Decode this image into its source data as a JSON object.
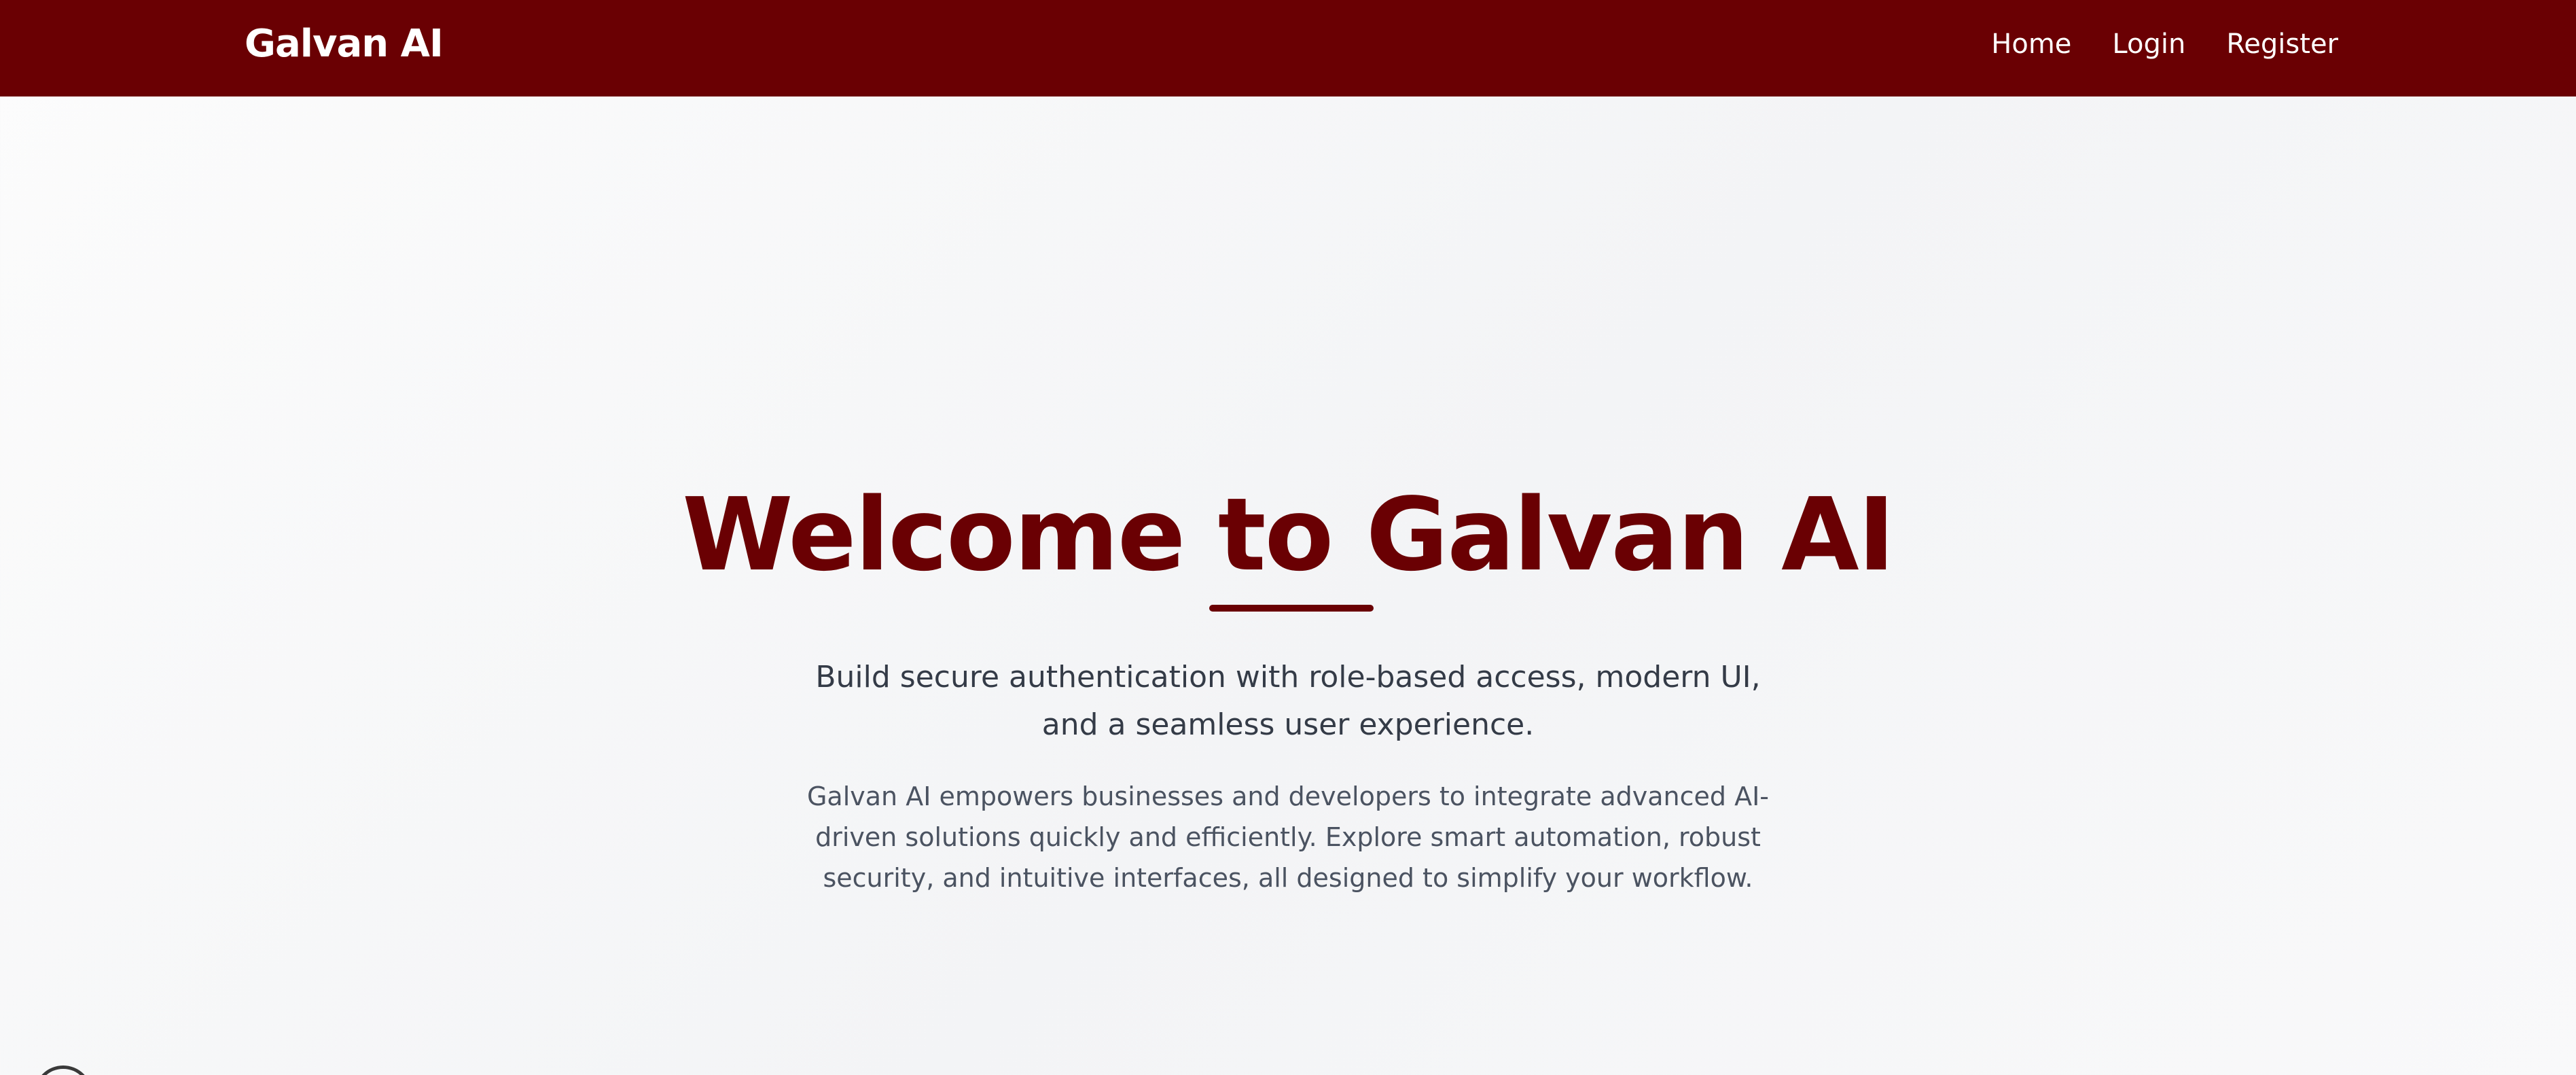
{
  "navbar": {
    "brand": "Galvan AI",
    "links": [
      {
        "label": "Home"
      },
      {
        "label": "Login"
      },
      {
        "label": "Register"
      }
    ]
  },
  "hero": {
    "title": "Welcome to Galvan AI",
    "subtitle": "Build secure authentication with role-based access, modern UI, and a seamless user experience.",
    "description": "Galvan AI empowers businesses and developers to integrate advanced AI-driven solutions quickly and efficiently. Explore smart automation, robust security, and intuitive interfaces, all designed to simplify your workflow."
  },
  "colors": {
    "brand": "#6a0003",
    "nav_text": "#ffffff",
    "subtitle_text": "#343b47",
    "body_text": "#4b5361"
  },
  "icons": {
    "corner": "circle-outline-icon"
  }
}
